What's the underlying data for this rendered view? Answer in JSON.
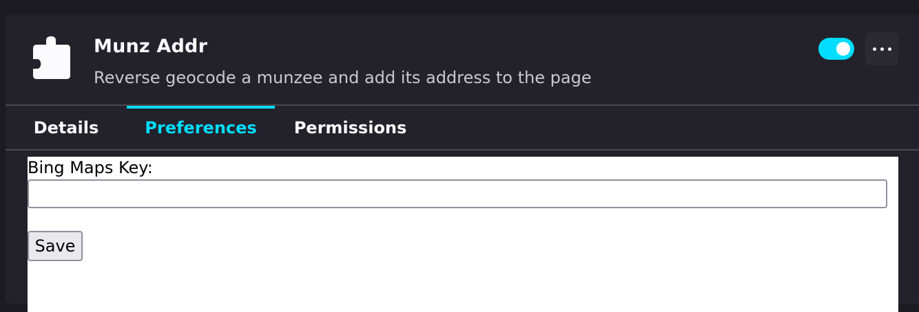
{
  "addon": {
    "name": "Munz Addr",
    "description": "Reverse geocode a munzee and add its address to the page",
    "enabled": true
  },
  "tabs": [
    {
      "label": "Details",
      "selected": false
    },
    {
      "label": "Preferences",
      "selected": true
    },
    {
      "label": "Permissions",
      "selected": false
    }
  ],
  "preferences": {
    "key_label": "Bing Maps Key:",
    "key_value": "",
    "key_placeholder": "",
    "save_label": "Save"
  },
  "colors": {
    "accent": "#00ddff",
    "card_background": "#23222b",
    "page_background": "#1c1b22"
  }
}
